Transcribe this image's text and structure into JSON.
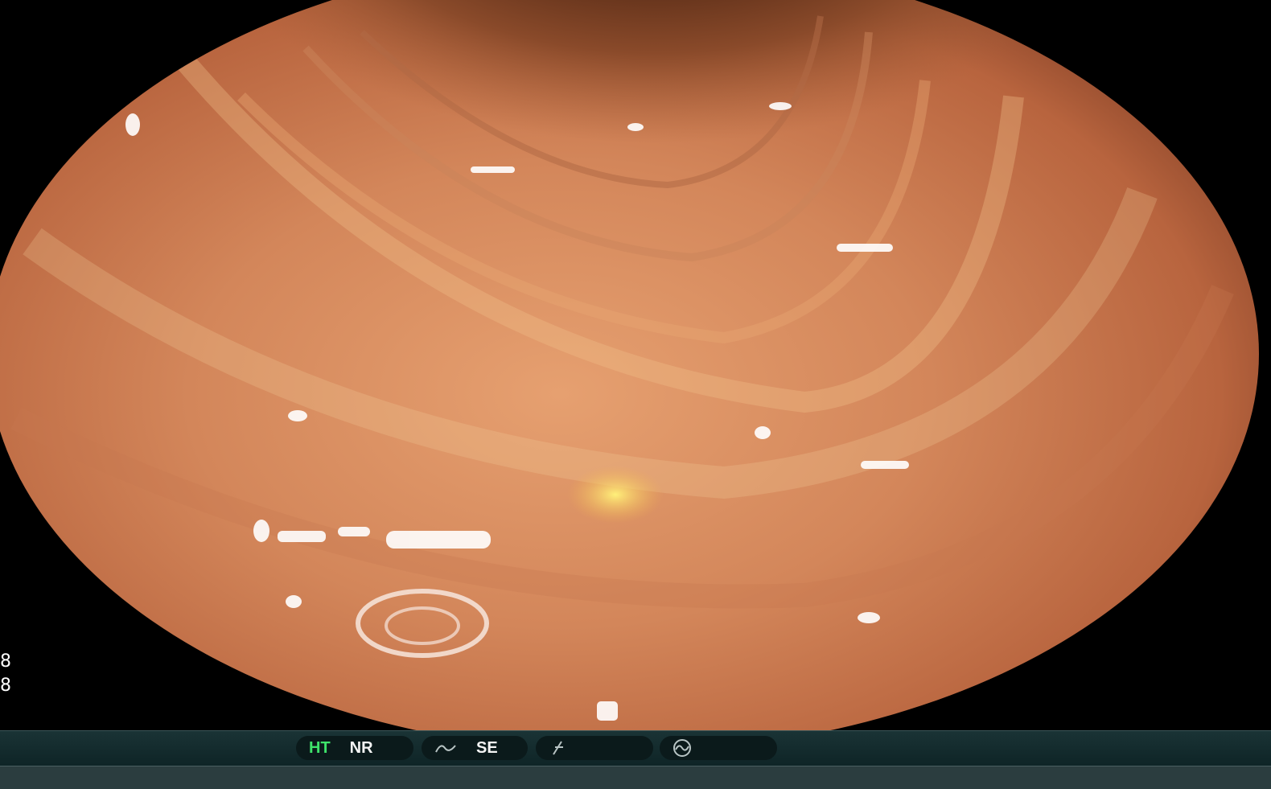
{
  "side_readout": [
    "8",
    "8"
  ],
  "status_bar": {
    "pill1": {
      "active": "HT",
      "second": "NR"
    },
    "pill2": {
      "label": "SE"
    },
    "active_color": "#3ee26a",
    "text_color": "#f4f4f4",
    "icons": [
      "curve-icon",
      "slash-f-icon",
      "circle-wave-icon"
    ]
  }
}
